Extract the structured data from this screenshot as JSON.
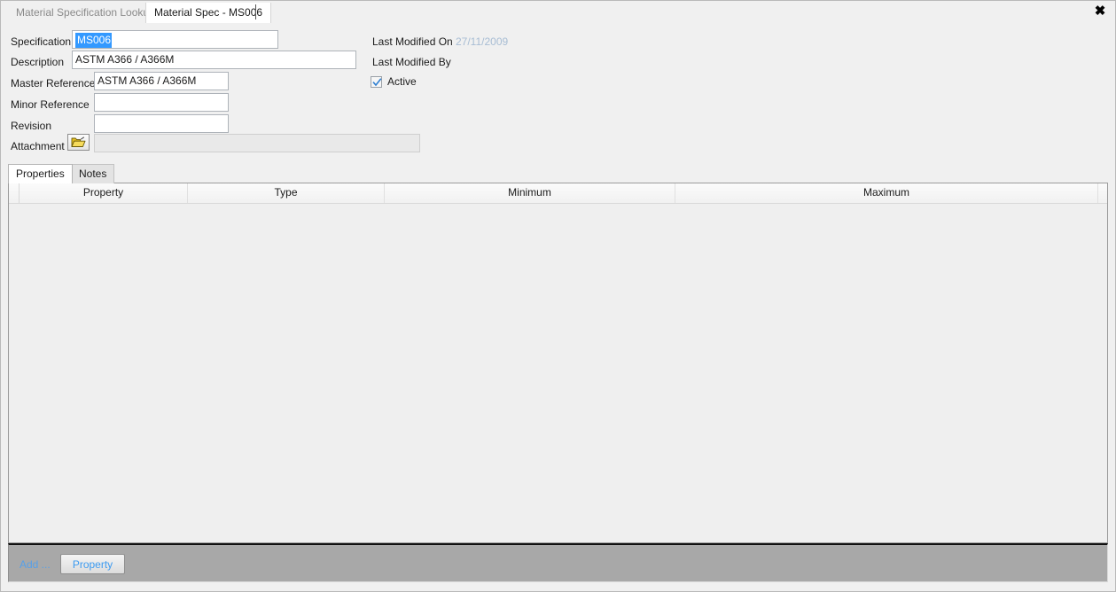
{
  "window": {
    "close_label": "✖"
  },
  "tabs": [
    {
      "label": "Material Specification Lookup",
      "active": false
    },
    {
      "label": "Material Spec - MS006",
      "active": true
    }
  ],
  "form": {
    "specification": {
      "label": "Specification",
      "value": "MS006",
      "selected": true
    },
    "description": {
      "label": "Description",
      "value": "ASTM A366 / A366M"
    },
    "master_reference": {
      "label": "Master Reference",
      "value": "ASTM A366 / A366M"
    },
    "minor_reference": {
      "label": "Minor Reference",
      "value": ""
    },
    "revision": {
      "label": "Revision",
      "value": ""
    },
    "attachment": {
      "label": "Attachment",
      "value": "",
      "icon": "open-folder-icon"
    },
    "last_modified_on": {
      "label": "Last Modified On",
      "value": "27/11/2009"
    },
    "last_modified_by": {
      "label": "Last Modified By",
      "value": ""
    },
    "active": {
      "label": "Active",
      "checked": true
    }
  },
  "inner_tabs": [
    {
      "label": "Properties",
      "active": true
    },
    {
      "label": "Notes",
      "active": false
    }
  ],
  "grid": {
    "columns": [
      "Property",
      "Type",
      "Minimum",
      "Maximum"
    ],
    "rows": []
  },
  "toolbar": {
    "add_label": "Add ...",
    "property_label": "Property"
  },
  "colors": {
    "accent_blue": "#3399ff",
    "link_blue": "#57a0e8",
    "button_text_blue": "#3d9bf0",
    "date_text": "#a8bdd4",
    "toolbar_gray": "#a8a8a8",
    "grid_bg": "#efefef",
    "window_bg": "#f0f0f0"
  }
}
